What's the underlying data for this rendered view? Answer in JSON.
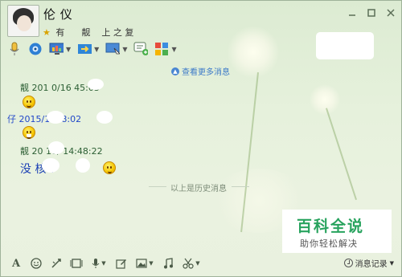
{
  "header": {
    "name": "伦 仪",
    "status_prefix": "有",
    "status_text": "靓",
    "status_rest": "上     之   复"
  },
  "window_buttons": [
    "minimize-icon",
    "restore-icon",
    "close-icon"
  ],
  "toolbar_icons": [
    "microphone-icon",
    "video-icon",
    "screen-share-icon",
    "file-transfer-icon",
    "remote-desktop-icon",
    "message-icon",
    "apps-icon"
  ],
  "more_messages": "查看更多消息",
  "messages": [
    {
      "header": "靓 201  0/16    45:03",
      "color": "#2c5f34",
      "content": "smiley"
    },
    {
      "header": "仔        2015/1      :48:02",
      "color": "#2147c9",
      "content": "grin"
    },
    {
      "header": "靓   20     10/   14:48:22",
      "color": "#2c5f34",
      "text": "没    核   ？"
    }
  ],
  "history_divider": "以上是历史消息",
  "watermark": {
    "title": "百科全说",
    "subtitle": "助你轻松解决"
  },
  "bottom_tools": [
    "font-icon",
    "emoji-icon",
    "shake-icon",
    "image-icon",
    "voice-icon",
    "edit-icon",
    "picture-icon",
    "music-icon",
    "scissors-icon"
  ],
  "history_button": "消息记录",
  "colors": {
    "accent": "#3d7ac8",
    "watermark_green": "#28a35e"
  }
}
